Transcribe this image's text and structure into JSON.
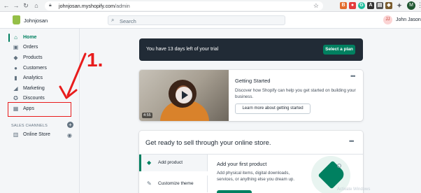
{
  "browser": {
    "url_host": "johnjosan.myshopify.com",
    "url_path": "/admin",
    "profile_initial": "M"
  },
  "topbar": {
    "store_name": "Johnjosan",
    "search_placeholder": "Search",
    "user_initials": "JJ",
    "user_name": "John Jason"
  },
  "sidebar": {
    "items": [
      {
        "label": "Home",
        "icon": "home-icon"
      },
      {
        "label": "Orders",
        "icon": "orders-icon"
      },
      {
        "label": "Products",
        "icon": "tag-icon"
      },
      {
        "label": "Customers",
        "icon": "person-icon"
      },
      {
        "label": "Analytics",
        "icon": "bar-chart-icon"
      },
      {
        "label": "Marketing",
        "icon": "megaphone-icon"
      },
      {
        "label": "Discounts",
        "icon": "discount-icon"
      },
      {
        "label": "Apps",
        "icon": "apps-grid-icon"
      }
    ],
    "sales_channels_title": "SALES CHANNELS",
    "online_store_label": "Online Store"
  },
  "annotation": {
    "step_number": "1.",
    "color": "#e81c1c"
  },
  "trial_banner": {
    "text": "You have 13 days left of your trial",
    "button": "Select a plan"
  },
  "getting_started": {
    "title": "Getting Started",
    "description": "Discover how Shopify can help you get started on building your business.",
    "button": "Learn more about getting started",
    "video_duration": "4:55"
  },
  "sell_card": {
    "title": "Get ready to sell through your online store.",
    "steps": [
      {
        "label": "Add product",
        "icon": "tag-icon"
      },
      {
        "label": "Customize theme",
        "icon": "brush-icon"
      }
    ],
    "add_first_product_title": "Add your first product",
    "add_first_product_desc": "Add physical items, digital downloads, services, or anything else you dream up."
  },
  "watermark": "Activate Windows",
  "colors": {
    "accent": "#008060",
    "dark_banner": "#212b36",
    "shopify_green": "#95bf47"
  }
}
